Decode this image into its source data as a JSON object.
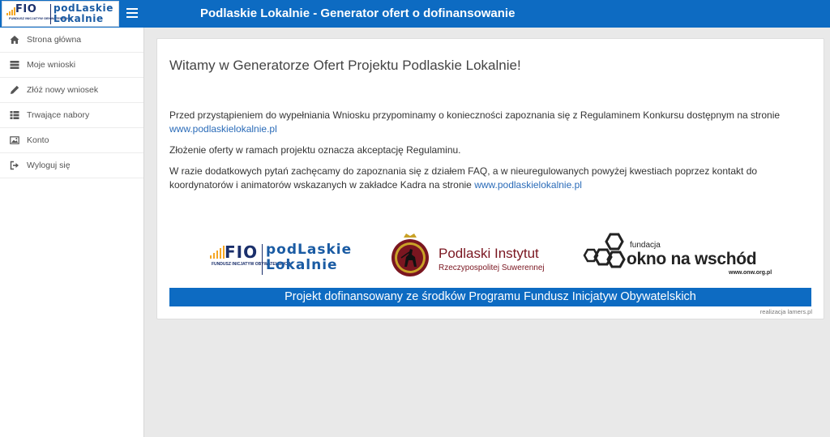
{
  "header": {
    "title": "Podlaskie Lokalnie - Generator ofert o dofinansowanie",
    "logo_fio": "FIO",
    "logo_fio_sub": "FUNDUSZ INICJATYW OBYWATELSKICH",
    "logo_pl_line1": "podLaskie",
    "logo_pl_line2": "Lokalnie",
    "accent_color": "#0d6bc2"
  },
  "sidebar": {
    "items": [
      {
        "label": "Strona główna",
        "icon": "home-icon"
      },
      {
        "label": "Moje wnioski",
        "icon": "list-icon"
      },
      {
        "label": "Złóż nowy wniosek",
        "icon": "pencil-icon"
      },
      {
        "label": "Trwające nabory",
        "icon": "table-icon"
      },
      {
        "label": "Konto",
        "icon": "image-icon"
      },
      {
        "label": "Wyloguj się",
        "icon": "logout-icon"
      }
    ]
  },
  "main": {
    "welcome": "Witamy w Generatorze Ofert Projektu Podlaskie Lokalnie!",
    "p1_text": "Przed przystąpieniem do wypełniania Wniosku przypominamy o konieczności zapoznania się z Regulaminem Konkursu dostępnym na stronie ",
    "p1_link": "www.podlaskielokalnie.pl",
    "p2_text": "Złożenie oferty w ramach projektu oznacza akceptację Regulaminu.",
    "p3_text": "W razie dodatkowych pytań zachęcamy do zapoznania się z działem FAQ, a w nieuregulowanych powyżej kwestiach poprzez kontakt do koordynatorów i animatorów wskazanych w zakładce Kadra na stronie ",
    "p3_link": "www.podlaskielokalnie.pl"
  },
  "logos": {
    "fio_big": "FIO",
    "fio_small": "FUNDUSZ INICJATYW OBYWATELSKICH",
    "fio_pl_line1": "podLaskie",
    "fio_pl_line2": "Lokalnie",
    "pi_name": "Podlaski Instytut",
    "pi_sub": "Rzeczypospolitej Suwerennej",
    "onw_pre": "fundacja",
    "onw_name": "okno na wschód",
    "onw_url": "www.onw.org.pl"
  },
  "footer": {
    "banner": "Projekt dofinansowany ze środków Programu Fundusz Inicjatyw Obywatelskich",
    "credit": "realizacja lamers.pl"
  }
}
